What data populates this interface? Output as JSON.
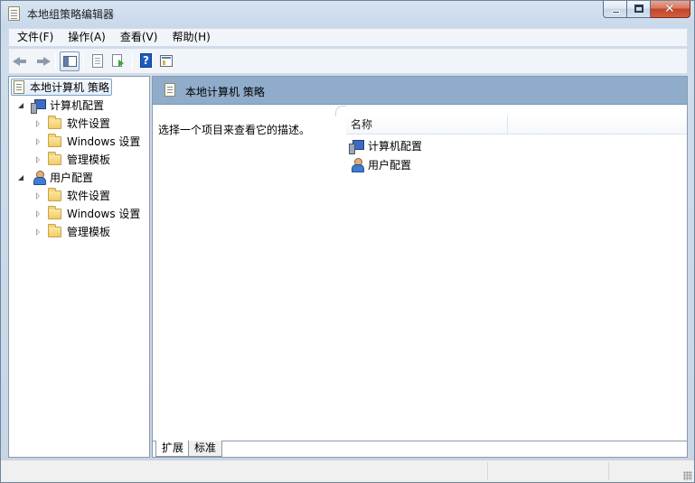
{
  "window": {
    "title": "本地组策略编辑器",
    "caption_buttons": [
      "minimize",
      "maximize",
      "close"
    ]
  },
  "menu": [
    {
      "label": "文件(F)"
    },
    {
      "label": "操作(A)"
    },
    {
      "label": "查看(V)"
    },
    {
      "label": "帮助(H)"
    }
  ],
  "toolbar": {
    "icons": [
      "back-arrow-icon",
      "forward-arrow-icon",
      "show-hide-tree-icon",
      "properties-icon",
      "export-list-icon",
      "help-icon",
      "console-view-icon"
    ]
  },
  "tree": {
    "root": "本地计算机 策略",
    "nodes": [
      {
        "label": "计算机配置",
        "expanded": true,
        "children": [
          "软件设置",
          "Windows 设置",
          "管理模板"
        ]
      },
      {
        "label": "用户配置",
        "expanded": true,
        "children": [
          "软件设置",
          "Windows 设置",
          "管理模板"
        ]
      }
    ]
  },
  "main": {
    "header_title": "本地计算机 策略",
    "description": "选择一个项目来查看它的描述。",
    "column_header": "名称",
    "items": [
      "计算机配置",
      "用户配置"
    ],
    "tabs": [
      "扩展",
      "标准"
    ],
    "active_tab": "扩展"
  },
  "colors": {
    "header_band": "#8fadcb",
    "frame": "#c9d9ea",
    "selection_border": "#7da2ce"
  }
}
